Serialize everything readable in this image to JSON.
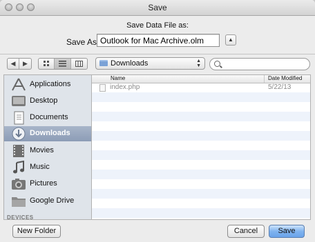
{
  "window": {
    "title": "Save"
  },
  "save_panel": {
    "caption": "Save Data File as:",
    "save_as_label": "Save As:",
    "filename": "Outlook for Mac Archive.olm"
  },
  "toolbar": {
    "back_glyph": "◀",
    "forward_glyph": "▶",
    "view_icons": [
      "icon-view-icon",
      "list-view-icon",
      "column-view-icon"
    ],
    "location": "Downloads",
    "search_value": ""
  },
  "sidebar": {
    "items": [
      {
        "label": "Applications",
        "icon": "applications-icon"
      },
      {
        "label": "Desktop",
        "icon": "desktop-icon"
      },
      {
        "label": "Documents",
        "icon": "documents-icon"
      },
      {
        "label": "Downloads",
        "icon": "downloads-icon",
        "selected": true
      },
      {
        "label": "Movies",
        "icon": "movies-icon"
      },
      {
        "label": "Music",
        "icon": "music-icon"
      },
      {
        "label": "Pictures",
        "icon": "pictures-icon"
      },
      {
        "label": "Google Drive",
        "icon": "folder-icon"
      }
    ],
    "section_label": "DEVICES"
  },
  "file_list": {
    "columns": {
      "name": "Name",
      "date": "Date Modified"
    },
    "files": [
      {
        "name": "index.php",
        "date": "5/22/13"
      }
    ]
  },
  "buttons": {
    "new_folder": "New Folder",
    "cancel": "Cancel",
    "save": "Save"
  },
  "colors": {
    "selection": "#8c9cb6",
    "default_button": "#6aa3ea",
    "row_alt": "#eef3fb"
  }
}
